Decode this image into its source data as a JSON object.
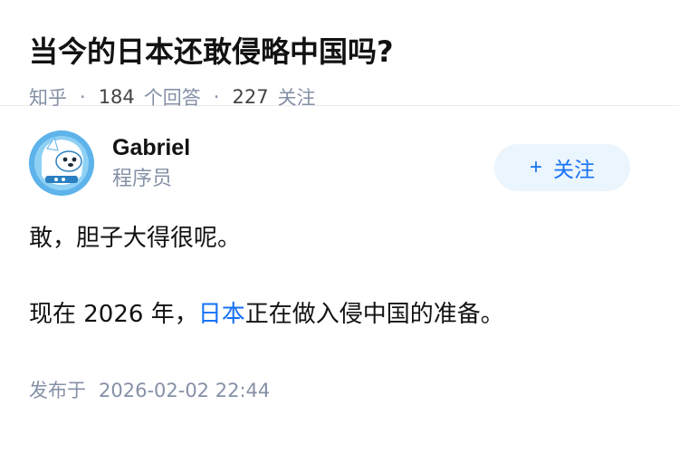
{
  "question": {
    "title": "当今的日本还敢侵略中国吗?",
    "source": "知乎",
    "answers_count": "184",
    "answers_label": "个回答",
    "followers_count": "227",
    "followers_label": "关注",
    "separator": "·"
  },
  "author": {
    "name": "Gabriel",
    "headline": "程序员",
    "avatar_icon": "robot-dog-avatar",
    "follow_plus": "+",
    "follow_label": "关注"
  },
  "answer": {
    "paragraph1": "敢，胆子大得很呢。",
    "paragraph2_prefix": "现在 2026 年，",
    "paragraph2_link": "日本",
    "paragraph2_suffix": "正在做入侵中国的准备。",
    "published_label": "发布于",
    "published_date": "2026-02-02 22:44"
  },
  "colors": {
    "accent": "#1772f6",
    "meta_gray": "#8590a6",
    "follow_bg": "#ebf5fd",
    "avatar_bg": "#5db3ea"
  }
}
